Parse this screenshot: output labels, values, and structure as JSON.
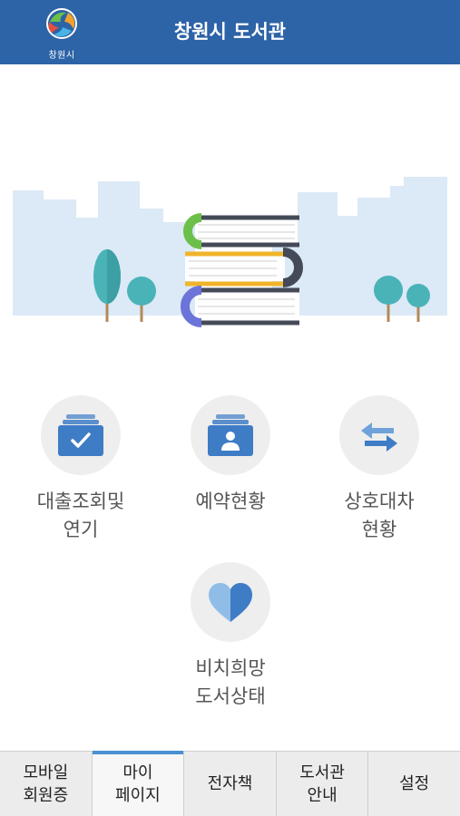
{
  "header": {
    "title": "창원시 도서관",
    "logo_text": "창원시",
    "logo_icon": "changwon-city-logo-icon"
  },
  "hero": {
    "illustration": "books-city-illustration"
  },
  "menu": [
    {
      "label": "대출조회및\n연기",
      "icon": "checkbox-folder-icon"
    },
    {
      "label": "예약현황",
      "icon": "user-folder-icon"
    },
    {
      "label": "상호대차\n현황",
      "icon": "exchange-arrows-icon"
    },
    {
      "label": "비치희망\n도서상태",
      "icon": "heart-icon"
    }
  ],
  "tabs": [
    {
      "label": "모바일\n회원증",
      "active": false
    },
    {
      "label": "마이\n페이지",
      "active": true
    },
    {
      "label": "전자책",
      "active": false
    },
    {
      "label": "도서관\n안내",
      "active": false
    },
    {
      "label": "설정",
      "active": false
    }
  ],
  "colors": {
    "header_bg": "#2d63a7",
    "icon_blue": "#3f7cc6",
    "active_tab_indicator": "#4a90d2",
    "skyline": "#dce9f6"
  }
}
